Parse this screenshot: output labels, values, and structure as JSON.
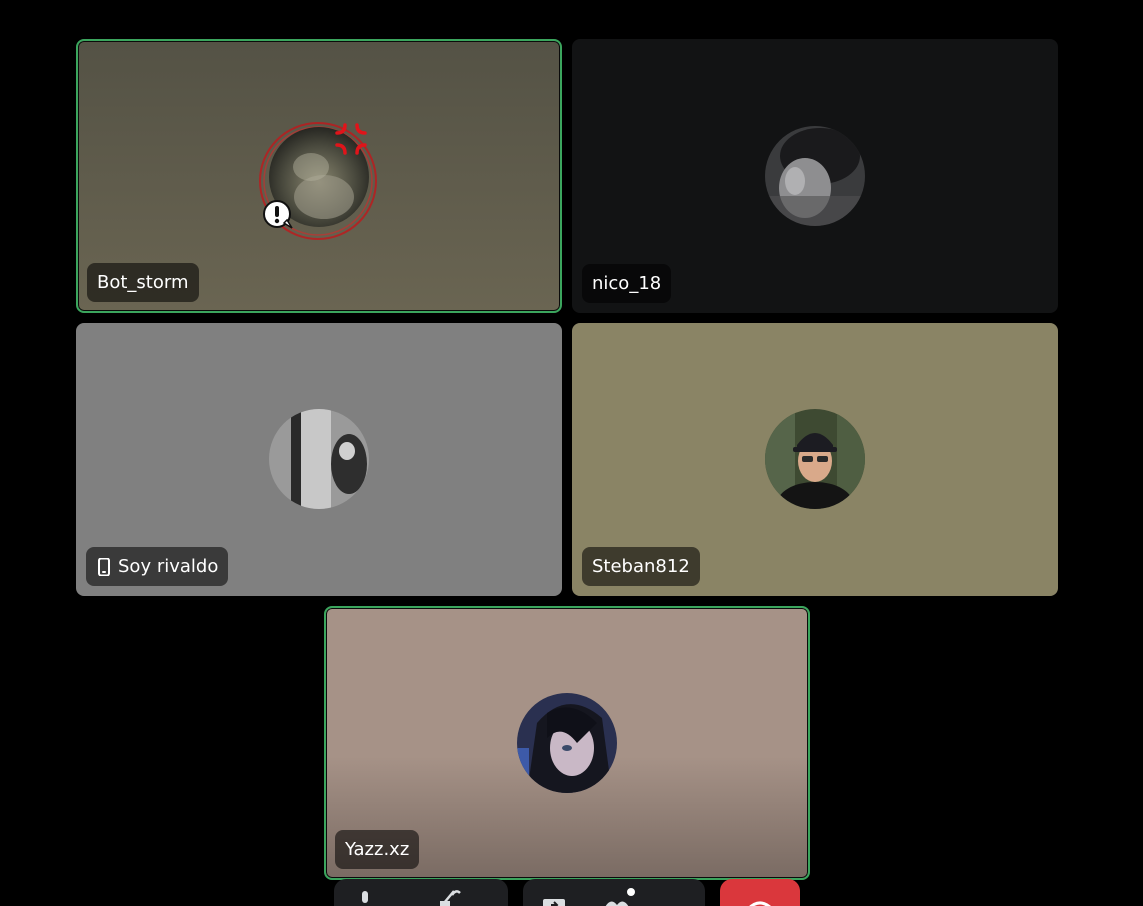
{
  "participants": [
    {
      "name": "Bot_storm",
      "speaking": true,
      "bg": "#5c5849"
    },
    {
      "name": "nico_18",
      "speaking": false,
      "bg": "#121314"
    },
    {
      "name": "Soy rivaldo",
      "speaking": false,
      "mobile": true,
      "bg": "#808080"
    },
    {
      "name": "Steban812",
      "speaking": false,
      "bg": "#8a8465"
    },
    {
      "name": "Yazz.xz",
      "speaking": true,
      "bg": "#a69287"
    }
  ],
  "colors": {
    "speaking_border": "#3ba55d",
    "hangup": "#da373c",
    "control_bg": "#1e1f22"
  },
  "controls": {
    "icons": [
      "microphone-icon",
      "mute-icon",
      "share-screen-icon",
      "activity-icon",
      "hang-up-icon"
    ]
  }
}
